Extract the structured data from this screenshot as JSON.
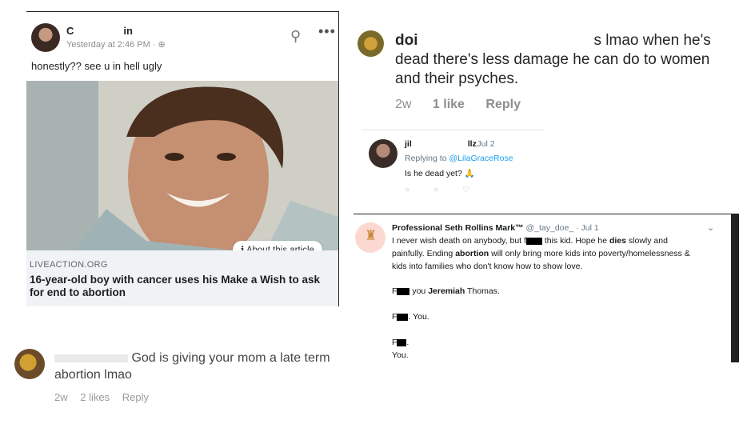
{
  "fb_post": {
    "name_visible": "C in",
    "time": "Yesterday at 2:46 PM · ",
    "text": "honestly?? see u in hell ugly",
    "about": "About this article",
    "domain": "LIVEACTION.ORG",
    "headline": "16-year-old boy with cancer uses his Make a Wish to ask for end to abortion"
  },
  "ig_comment": {
    "user": "doi",
    "text_after": "s lmao when he's dead there's less damage he can do to women and their psyches.",
    "age": "2w",
    "likes": "1 like",
    "reply": "Reply"
  },
  "tw_reply_small": {
    "name": "jil",
    "name_end": "llz",
    "date": "· Jul 2",
    "replying_prefix": "Replying to ",
    "mention": "@LilaGraceRose",
    "text": "Is he dead yet? 🙏"
  },
  "tw_reply_large": {
    "name": "Professional Seth Rollins Mark™",
    "handle": "@_tay_doe_ · Jul 1",
    "line1a": "I never wish death on anybody, but f",
    "line1b": " this kid. Hope he ",
    "line1c": "dies",
    "line1d": " slowly and",
    "line2a": "painfully. Ending ",
    "line2b": "abortion",
    "line2c": " will only bring more kids into poverty/homelessness &",
    "line3": "kids into families who don't know how to show love.",
    "line4a": "F",
    "line4b": " you ",
    "line4c": "Jeremiah",
    "line4d": " Thomas.",
    "line5a": "F",
    "line5b": ". You.",
    "line6a": "F",
    "line6b": ".",
    "line7": "You."
  },
  "fb_comment": {
    "text": "God is giving your mom a late term abortion lmao",
    "age": "2w",
    "likes": "2 likes",
    "reply": "Reply"
  }
}
